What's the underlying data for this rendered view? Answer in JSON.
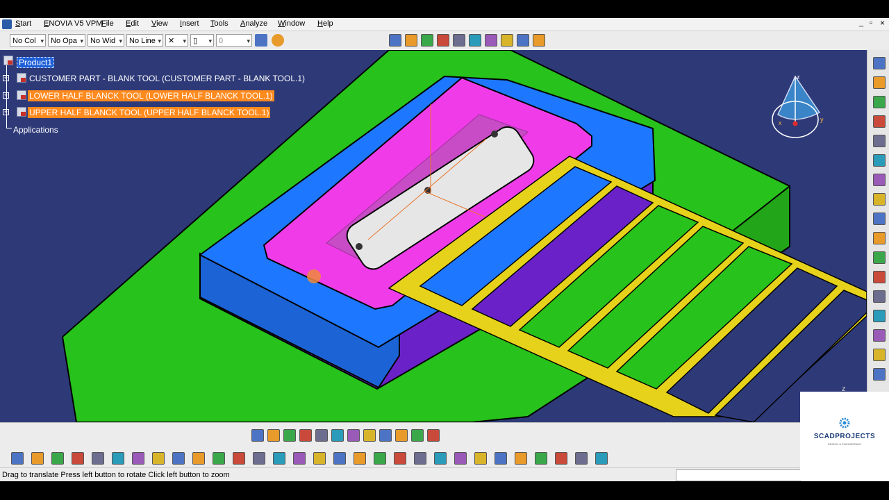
{
  "titlebar": {
    "start": "Start",
    "enovia": "ENOVIA V5 VPM",
    "menus": [
      "File",
      "Edit",
      "View",
      "Insert",
      "Tools",
      "Analyze",
      "Window",
      "Help"
    ],
    "window_controls": [
      "_",
      "▫",
      "×"
    ]
  },
  "property_toolbar": {
    "color": "No Col",
    "opacity": "No Opa",
    "width": "No Wid",
    "linetype": "No Line",
    "layer_value": "0"
  },
  "tree": {
    "root": "Product1",
    "items": [
      {
        "label": "CUSTOMER PART - BLANK TOOL (CUSTOMER PART - BLANK TOOL.1)",
        "highlight": false
      },
      {
        "label": "LOWER HALF BLANCK TOOL (LOWER HALF BLANCK TOOL.1)",
        "highlight": true
      },
      {
        "label": "UPPER HALF BLANCK TOOL (UPPER HALF BLANCK TOOL.1)",
        "highlight": true
      }
    ],
    "applications": "Applications"
  },
  "compass": {
    "x": "x",
    "y": "y",
    "z": "z"
  },
  "view_axis_label": "z",
  "status": {
    "message": "Drag to translate  Press left button to rotate  Click left button to zoom"
  },
  "logo": {
    "name": "SCADPROJECTS",
    "tagline": "DESIGN & ENGINEERING"
  },
  "colors": {
    "viewport_bg": "#2e3a78",
    "base_plate": "#27c21b",
    "blue_block": "#1e78ff",
    "purple_block": "#6a22c8",
    "magenta_plate": "#f03ce8",
    "strip": "#e6d21a",
    "highlight": "#ff8a1e"
  },
  "icons": {
    "top_toolbar": [
      "apply-material-icon",
      "catalog-icon",
      "assembly-constraint-icon",
      "snap-icon",
      "manipulate-icon",
      "explode-icon",
      "clash-icon",
      "sectioning-icon",
      "measure-icon",
      "settings-icon"
    ],
    "right_toolbar": [
      "rotate-icon",
      "product-icon",
      "component-icon",
      "part-icon",
      "existing-component-icon",
      "replace-icon",
      "select-icon",
      "update-icon",
      "coincidence-icon",
      "contact-icon",
      "offset-icon",
      "angle-icon",
      "fix-icon",
      "fix-together-icon",
      "quick-constraint-icon",
      "flexible-icon",
      "measure-between-icon"
    ],
    "view_toolbar": [
      "fly-mode-icon",
      "fit-all-icon",
      "pan-icon",
      "rotate-view-icon",
      "zoom-in-icon",
      "zoom-out-icon",
      "normal-view-icon",
      "multi-view-icon",
      "iso-view-icon",
      "shading-icon",
      "hide-show-icon",
      "swap-space-icon"
    ],
    "standard_toolbar": [
      "new-icon",
      "open-icon",
      "save-icon",
      "print-icon",
      "cut-icon",
      "copy-icon",
      "paste-icon",
      "undo-icon",
      "redo-icon",
      "whats-this-icon",
      "formula-icon",
      "comment-icon",
      "knowledge-icon",
      "table-icon",
      "bom-icon",
      "publish-icon",
      "analysis-icon",
      "catalog-browser-icon",
      "scene-icon",
      "camera-icon",
      "generate-numbering-icon",
      "reorder-icon",
      "move-icon",
      "save-management-icon",
      "render-icon",
      "sketch-icon",
      "material-icon",
      "applied-material-icon",
      "apply-icon",
      "grid-icon"
    ]
  }
}
